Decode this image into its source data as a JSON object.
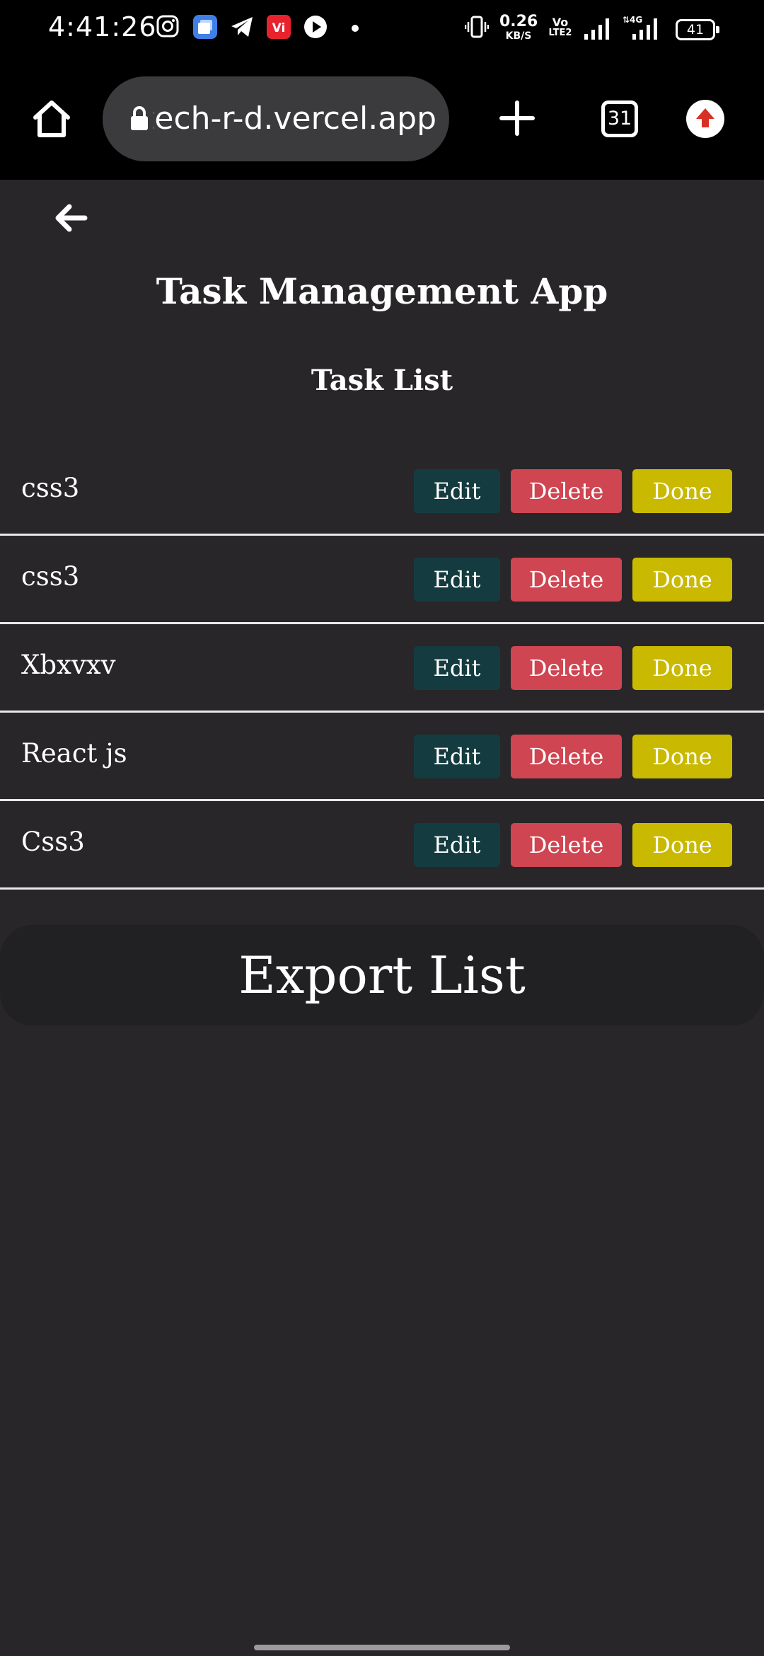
{
  "status_bar": {
    "time": "4:41:26",
    "net_speed_value": "0.26",
    "net_speed_unit": "KB/S",
    "volte_top": "Vo",
    "volte_bottom": "LTE2",
    "network": "4G",
    "battery": "41",
    "notification_icons": [
      "instagram-icon",
      "multi-window-icon",
      "telegram-icon",
      "vi-app-icon",
      "play-icon",
      "dot-icon"
    ]
  },
  "browser": {
    "url": "tech-r-d.vercel.app",
    "tabs_count": "31",
    "icons": [
      "home-icon",
      "lock-icon",
      "new-tab-icon",
      "tabs-icon",
      "update-icon"
    ]
  },
  "page": {
    "title": "Task Management App",
    "list_title": "Task List",
    "tasks": [
      {
        "name": "css3"
      },
      {
        "name": "css3"
      },
      {
        "name": "Xbxvxv"
      },
      {
        "name": "React js"
      },
      {
        "name": "Css3"
      }
    ],
    "buttons": {
      "edit": "Edit",
      "delete": "Delete",
      "done": "Done"
    },
    "export_label": "Export List"
  },
  "colors": {
    "background": "#282628",
    "edit": "#143c40",
    "delete": "#cf4551",
    "done": "#c9b900",
    "export_bg": "#212022"
  }
}
